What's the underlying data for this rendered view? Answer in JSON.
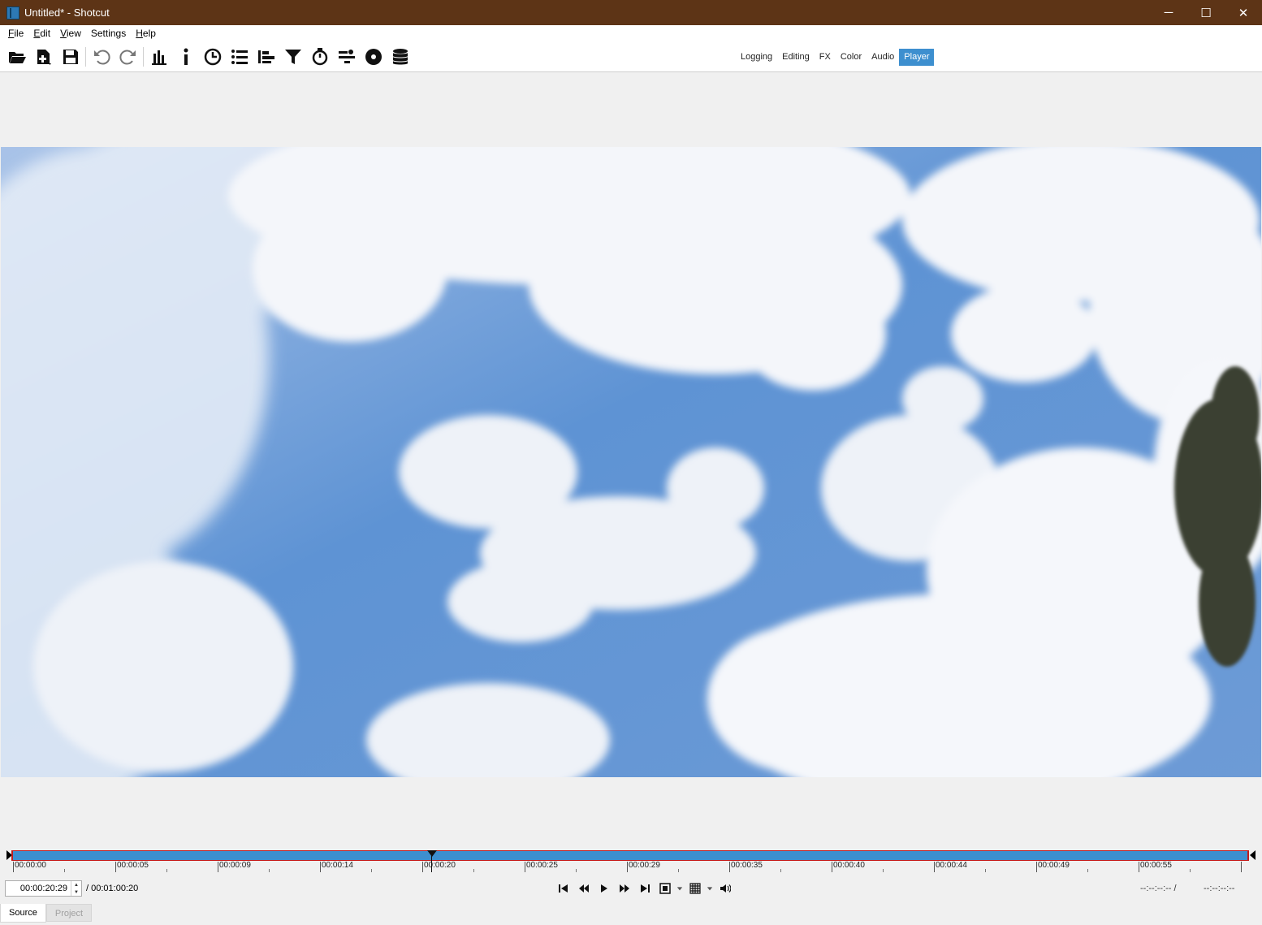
{
  "window": {
    "title": "Untitled* - Shotcut",
    "controls": {
      "minimize": "─",
      "maximize": "☐",
      "close": "✕"
    },
    "titlebar_color": "#5d3416"
  },
  "menu": {
    "items": [
      {
        "label": "File",
        "mnemonic": "F",
        "rest": "ile"
      },
      {
        "label": "Edit",
        "mnemonic": "E",
        "rest": "dit"
      },
      {
        "label": "View",
        "mnemonic": "V",
        "rest": "iew"
      },
      {
        "label": "Settings",
        "mnemonic": "",
        "rest": "Settings"
      },
      {
        "label": "Help",
        "mnemonic": "H",
        "rest": "elp"
      }
    ]
  },
  "toolbar": {
    "icons": [
      "open-folder-icon",
      "open-other-icon",
      "save-icon",
      "undo-icon",
      "redo-icon",
      "peak-meter-icon",
      "properties-icon",
      "recent-icon",
      "playlist-icon",
      "timeline-icon",
      "filters-icon",
      "keyframes-icon",
      "history-icon",
      "export-icon",
      "jobs-icon"
    ],
    "layouts": [
      "Logging",
      "Editing",
      "FX",
      "Color",
      "Audio",
      "Player"
    ],
    "active_layout": "Player",
    "accent_color": "#3d8fcf"
  },
  "scrubber": {
    "tick_labels": [
      "00:00:00",
      "00:00:05",
      "00:00:09",
      "00:00:14",
      "00:00:20",
      "00:00:25",
      "00:00:29",
      "00:00:35",
      "00:00:40",
      "00:00:44",
      "00:00:49",
      "00:00:55"
    ],
    "playhead_position_fraction": 0.339,
    "in_color": "#c21b1b"
  },
  "transport": {
    "timecode": "00:00:20:29",
    "duration": "/ 00:01:00:20",
    "in_point": "--:--:--:-- /",
    "out_point": "--:--:--:--",
    "buttons": [
      "skip-to-start-icon",
      "rewind-icon",
      "play-icon",
      "fast-forward-icon",
      "skip-to-end-icon",
      "zoom-icon",
      "grid-icon",
      "volume-icon"
    ]
  },
  "tabs": {
    "source": "Source",
    "project": "Project"
  }
}
